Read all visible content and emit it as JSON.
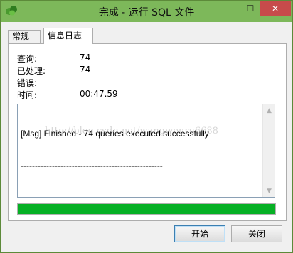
{
  "window": {
    "title": "完成 - 运行 SQL 文件",
    "controls": {
      "minimize": "—",
      "maximize": "☐",
      "close": "✕"
    },
    "accent": "#7db85a"
  },
  "tabs": [
    {
      "label": "常规",
      "active": false
    },
    {
      "label": "信息日志",
      "active": true
    }
  ],
  "stats": {
    "query_label": "查询:",
    "query_value": "74",
    "processed_label": "已处理:",
    "processed_value": "74",
    "error_label": "错误:",
    "error_value": "",
    "time_label": "时间:",
    "time_value": "00:47.59"
  },
  "log": {
    "line1": "[Msg] Finished - 74 queries executed successfully",
    "line2": "--------------------------------------------------",
    "watermark": "http://blog.csdn.net/wangwenru6688"
  },
  "progress": {
    "fraction": 1.0,
    "color": "#06b025"
  },
  "buttons": {
    "start": "开始",
    "close": "关闭"
  }
}
